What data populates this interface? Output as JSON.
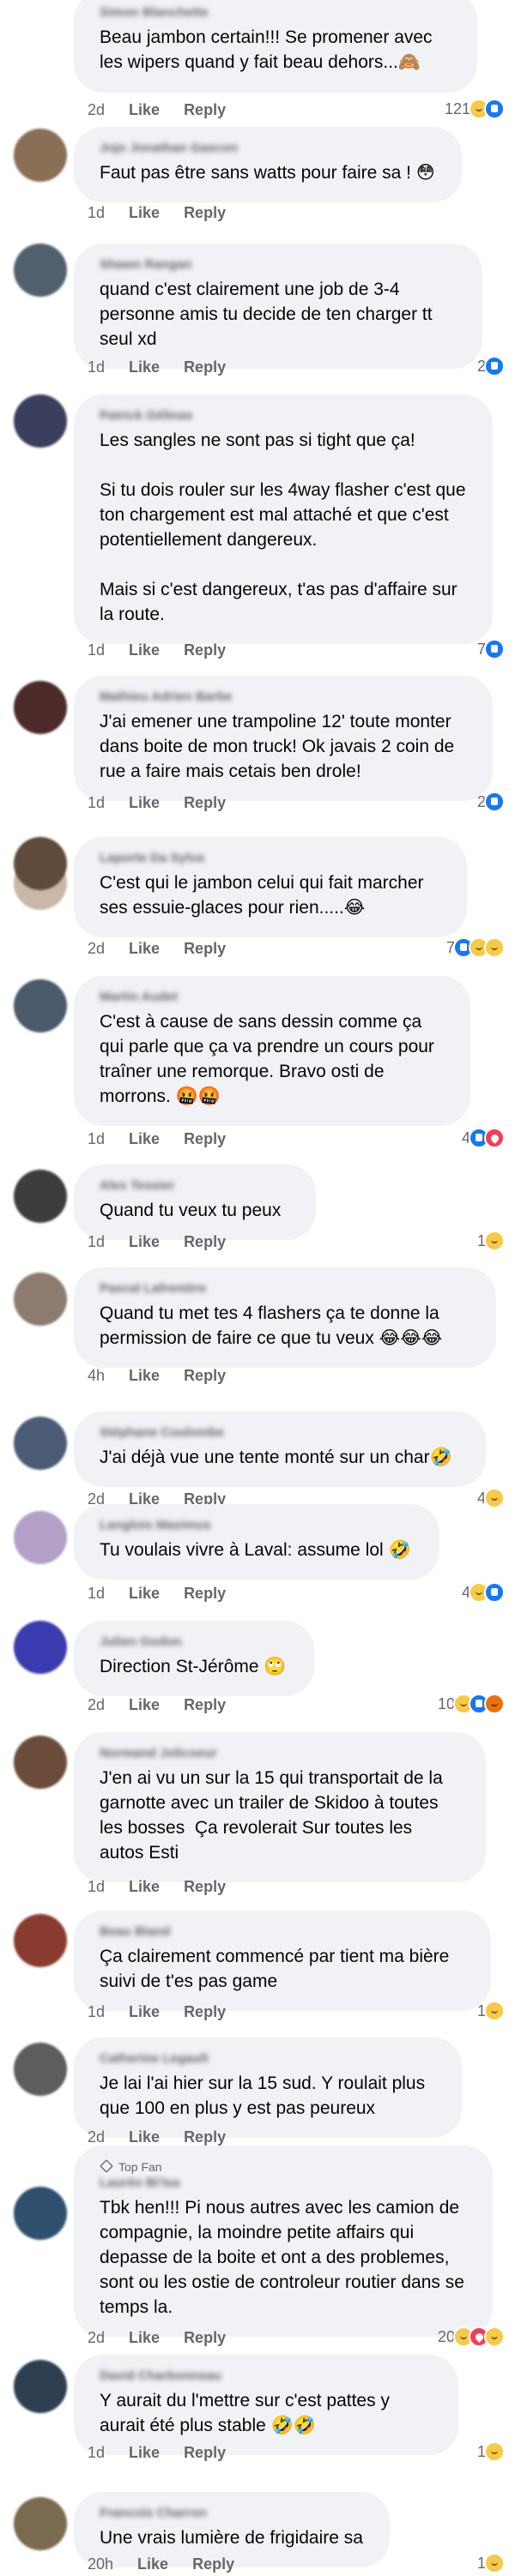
{
  "actions": {
    "like": "Like",
    "reply": "Reply"
  },
  "comments": [
    {
      "author": "Simon Blanchette",
      "text": "Beau jambon certain!!! Se promener avec les wipers quand y fait beau dehors...🙈",
      "time": "2d",
      "count": "121",
      "reactions": [
        "haha",
        "like"
      ]
    },
    {
      "author": "Jojo Jonathan Gascon",
      "text": "Faut pas être sans watts pour faire sa ! 😳",
      "time": "1d",
      "count": "",
      "reactions": []
    },
    {
      "author": "Shawn Rangan",
      "text": "quand c'est clairement une job de 3-4 personne amis tu decide de ten charger tt seul xd",
      "time": "1d",
      "count": "2",
      "reactions": [
        "like"
      ]
    },
    {
      "author": "Patrick Gélinas",
      "text": "Les sangles ne sont pas si tight que ça!\n\nSi tu dois rouler sur les 4way flasher c'est que ton chargement est mal attaché et que c'est potentiellement dangereux.\n\nMais si c'est dangereux, t'as pas d'affaire sur la route.",
      "time": "1d",
      "count": "7",
      "reactions": [
        "like"
      ]
    },
    {
      "author": "Mathieu Adrien Barbe",
      "text": "J'ai emener une trampoline 12' toute monter dans boite de mon truck! Ok javais 2 coin de rue a faire mais cetais ben drole!",
      "time": "1d",
      "count": "2",
      "reactions": [
        "like"
      ]
    },
    {
      "author": "Laporte Da Sylva",
      "text": "C'est qui le jambon celui qui fait marcher ses essuie-glaces pour rien.....😂",
      "time": "2d",
      "count": "7",
      "reactions": [
        "like",
        "haha",
        "wow"
      ]
    },
    {
      "author": "Martin Audet",
      "text": "C'est à cause de sans dessin comme ça qui parle que ça va prendre un cours pour traîner une remorque. Bravo osti de morrons. 🤬🤬",
      "time": "1d",
      "count": "4",
      "reactions": [
        "like",
        "love"
      ]
    },
    {
      "author": "Alex Tessier",
      "text": "Quand tu veux tu peux",
      "time": "1d",
      "count": "1",
      "reactions": [
        "haha"
      ]
    },
    {
      "author": "Pascal Lafrenière",
      "text": "Quand tu met tes 4 flashers ça te donne la permission de faire ce que tu veux 😂😂😂",
      "time": "4h",
      "count": "",
      "reactions": []
    },
    {
      "author": "Stéphane Coulombe",
      "text": "J'ai déjà vue une tente monté sur un char🤣",
      "time": "2d",
      "count": "4",
      "reactions": [
        "haha"
      ]
    },
    {
      "author": "Langlois Maximus",
      "text": "Tu voulais vivre à Laval: assume lol 🤣",
      "time": "1d",
      "count": "4",
      "reactions": [
        "haha",
        "like"
      ]
    },
    {
      "author": "Julien Godon",
      "text": "Direction St-Jérôme 🙄",
      "time": "2d",
      "count": "10",
      "reactions": [
        "haha",
        "like",
        "angry"
      ]
    },
    {
      "author": "Normand Jolicoeur",
      "text": "J'en ai vu un sur la 15 qui transportait de la garnotte avec un trailer de Skidoo à toutes les bosses  Ça revolerait Sur toutes les autos Esti",
      "time": "1d",
      "count": "",
      "reactions": []
    },
    {
      "author": "Beau Bland",
      "text": "Ça clairement commencé par tient ma bière suivi de t'es pas game",
      "time": "1d",
      "count": "1",
      "reactions": [
        "haha"
      ]
    },
    {
      "author": "Catherine Legault",
      "text": "Je lai l'ai hier sur la 15 sud. Y roulait plus que 100 en plus y est pas peureux",
      "time": "2d",
      "count": "",
      "reactions": []
    },
    {
      "author": "Lauréo Bi'Isa",
      "badge": "Top Fan",
      "text": "Tbk hen!!! Pi nous autres avec les camion de compagnie, la moindre petite affairs qui depasse de la boite et ont a des problemes, sont ou les ostie de controleur routier dans se temps la.",
      "time": "2d",
      "count": "20",
      "reactions": [
        "haha",
        "love",
        "haha"
      ]
    },
    {
      "author": "David Charbonneau",
      "text": "Y aurait du l'mettre sur c'est pattes y aurait été plus stable 🤣🤣",
      "time": "1d",
      "count": "1",
      "reactions": [
        "haha"
      ]
    },
    {
      "author": "Francois Charron",
      "text": "Une vrais lumière de frigidaire sa",
      "time": "20h",
      "count": "1",
      "reactions": [
        "haha"
      ]
    }
  ]
}
